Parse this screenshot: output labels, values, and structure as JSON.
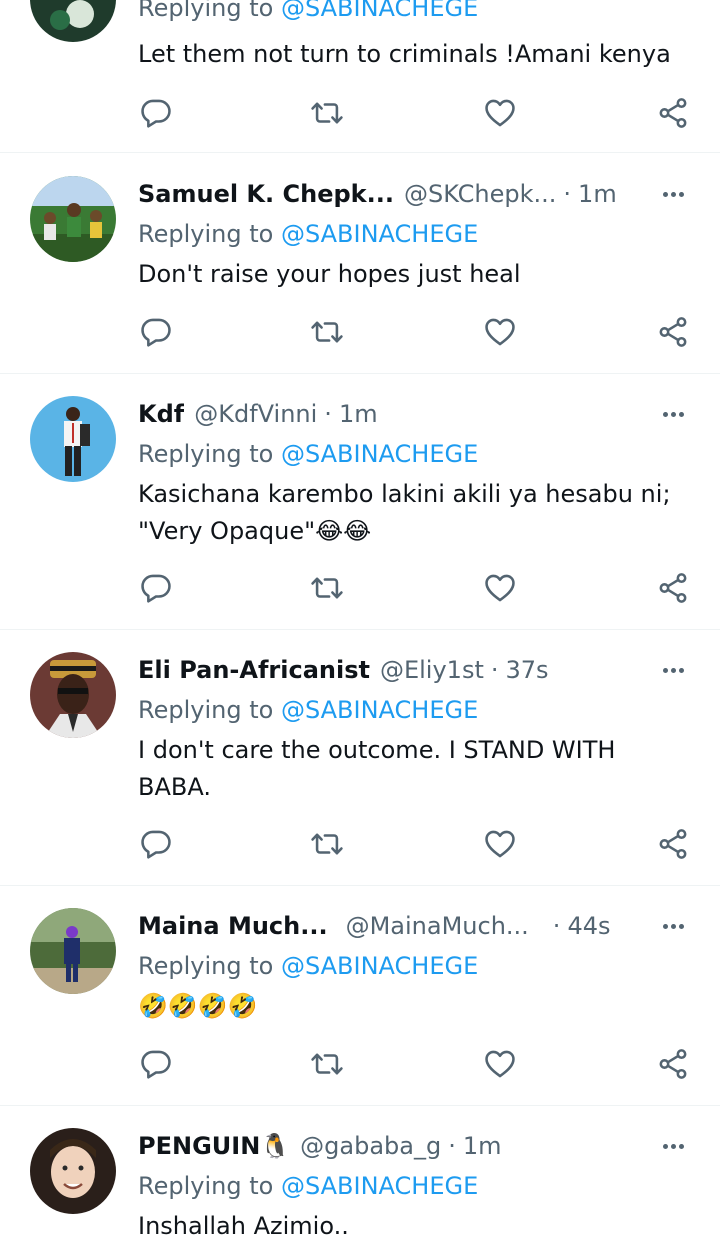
{
  "tweets": [
    {
      "replying_prefix": "Replying to",
      "mention": "@SABINACHEGE",
      "text": "Let them not turn to criminals !Amani kenya"
    },
    {
      "name": "Samuel K. Chepk...",
      "handle": "@SKChepk...",
      "time": "1m",
      "replying_prefix": "Replying to",
      "mention": "@SABINACHEGE",
      "text": "Don't raise your hopes just heal"
    },
    {
      "name": "Kdf",
      "handle": "@KdfVinni",
      "time": "1m",
      "replying_prefix": "Replying to",
      "mention": "@SABINACHEGE",
      "text": "Kasichana karembo lakini akili ya hesabu ni; \"Very Opaque\"😂😂"
    },
    {
      "name": "Eli Pan-Africanist",
      "handle": "@Eliy1st",
      "time": "37s",
      "replying_prefix": "Replying to",
      "mention": "@SABINACHEGE",
      "text": "I don't care the outcome. I STAND WITH BABA."
    },
    {
      "name": "Maina Much...",
      "handle": "@MainaMuch...",
      "time": "44s",
      "replying_prefix": "Replying to",
      "mention": "@SABINACHEGE",
      "text": "🤣🤣🤣🤣"
    },
    {
      "name": "PENGUIN🐧",
      "handle": "@gababa_g",
      "time": "1m",
      "replying_prefix": "Replying to",
      "mention": "@SABINACHEGE",
      "text": "Inshallah Azimio.."
    }
  ],
  "separator": "·",
  "icons": {
    "reply": "reply-icon",
    "retweet": "retweet-icon",
    "like": "like-icon",
    "share": "share-icon",
    "more": "more-icon"
  },
  "colors": {
    "link": "#1d9bf0",
    "secondary_text": "#536471",
    "divider": "#eff3f4",
    "avatar_tints": [
      "#1f3b2c",
      "#3a7a34",
      "#5ab4e6",
      "#6b3a34",
      "#4d6b3a",
      "#2a1f1a"
    ]
  }
}
